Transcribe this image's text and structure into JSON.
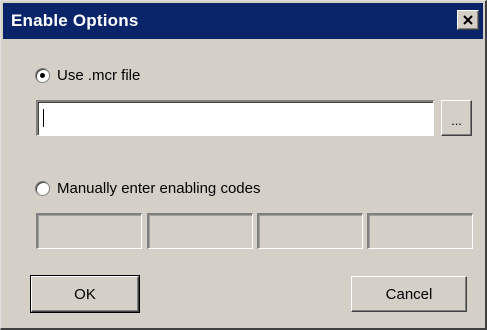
{
  "window": {
    "title": "Enable Options",
    "close_icon": "close-x-icon"
  },
  "options": {
    "use_mcr": {
      "label": "Use .mcr file",
      "selected": true
    },
    "mcr_path": {
      "value": ""
    },
    "browse_label": "...",
    "manual": {
      "label": "Manually enter enabling codes",
      "selected": false
    },
    "codes": [
      "",
      "",
      "",
      ""
    ]
  },
  "buttons": {
    "ok": "OK",
    "cancel": "Cancel"
  },
  "colors": {
    "title_bar": "#0a246a",
    "face": "#d4d0c8"
  }
}
